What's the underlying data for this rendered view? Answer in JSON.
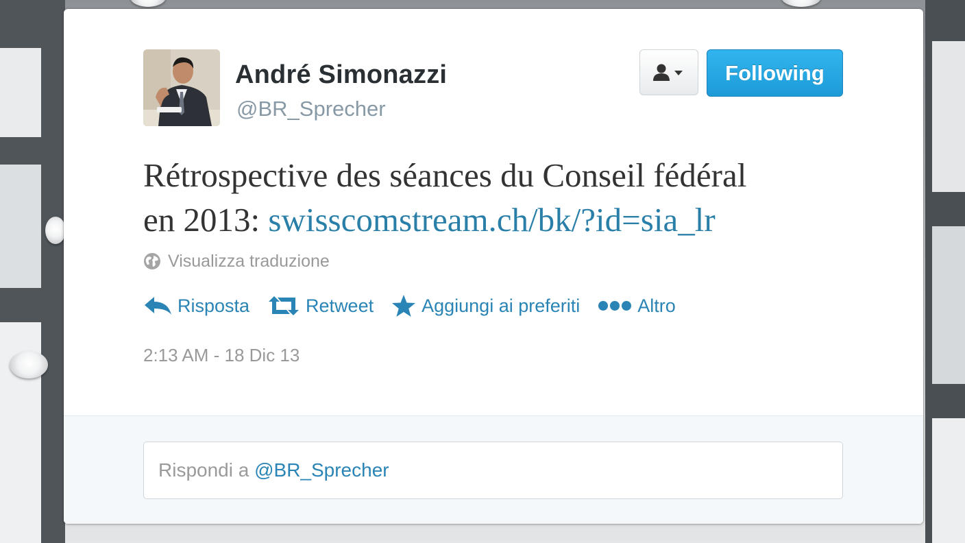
{
  "colors": {
    "accent": "#2a84b5",
    "follow_button": "#1d9bd8",
    "text_primary": "#292f33",
    "text_secondary": "#999999"
  },
  "tweet": {
    "author": {
      "name": "André Simonazzi",
      "handle": "@BR_Sprecher",
      "avatar_icon": "person-photo"
    },
    "user_menu_icon": "user-dropdown-icon",
    "follow_label": "Following",
    "text_lines": [
      "Rétrospective des séances du Conseil fédéral",
      "en 2013: "
    ],
    "link": "swisscomstream.ch/bk/?id=sia_lr",
    "translate_label": "Visualizza traduzione",
    "translate_icon": "globe-icon",
    "actions": [
      {
        "label": "Risposta",
        "icon": "reply-arrow-icon"
      },
      {
        "label": "Retweet",
        "icon": "retweet-icon"
      },
      {
        "label": "Aggiungi ai preferiti",
        "icon": "star-icon"
      },
      {
        "label": "Altro",
        "icon": "more-dots-icon"
      }
    ],
    "timestamp": "2:13 AM - 18 Dic 13"
  },
  "reply": {
    "prefix": "Rispondi a ",
    "mention": "@BR_Sprecher"
  }
}
